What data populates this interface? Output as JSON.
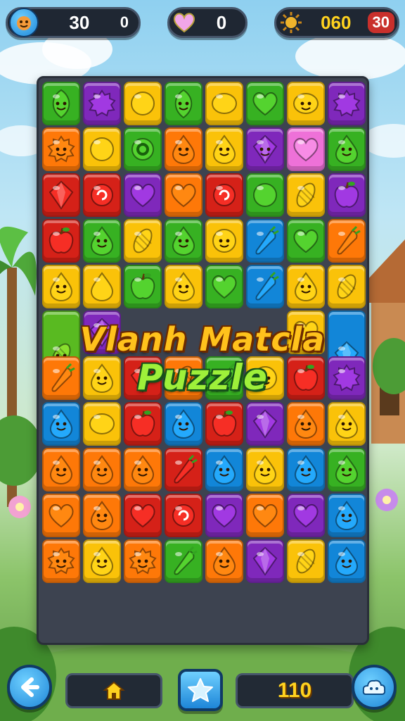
{
  "hud": {
    "lives_value": "30",
    "lives_extra": "0",
    "hearts_value": "0",
    "coins_value": "060",
    "coins_badge": "30"
  },
  "title": {
    "line1": "Vlanh Matcla",
    "line2": "Puzzle"
  },
  "footer": {
    "moves_value": "110"
  },
  "colors": {
    "board": "#3d4350",
    "title_line1": "#ffc21c",
    "title_line2": "#9ef03a",
    "button_blue": "#1e86d8"
  },
  "board": {
    "cols": 8,
    "rows": 12,
    "tiles": [
      [
        "green-leaf-face",
        "purple-splat",
        "yellow-orb",
        "green-leaf-face",
        "yellow-lemon",
        "green-heart",
        "yellow-lemon-face",
        "purple-splat"
      ],
      [
        "orange-sun-face",
        "yellow-orb",
        "green-ring",
        "orange-drop-face",
        "yellow-drop-face",
        "purple-gem-face",
        "pink-heart",
        "green-drop-face"
      ],
      [
        "red-gem",
        "red-swirl",
        "purple-heart",
        "orange-heart",
        "red-swirl",
        "green-orb",
        "yellow-corn",
        "purple-berry"
      ],
      [
        "red-apple",
        "green-drop-face",
        "yellow-corn",
        "green-drop-face",
        "yellow-orb-face",
        "blue-popsicle",
        "green-heart",
        "orange-carrot"
      ],
      [
        "yellow-drop-face",
        "yellow-drop",
        "green-apple",
        "yellow-drop-face",
        "green-heart",
        "blue-popsicle",
        "yellow-drop-face",
        "yellow-corn"
      ],
      [
        "corn-face-tall",
        "purple-gem",
        "empty",
        "empty",
        "empty",
        "empty",
        "yellow-heart",
        "blue-crystal-tall"
      ],
      [
        "orange-carrot",
        "yellow-drop-face",
        "red-gem",
        "orange-corn",
        "green-pepper",
        "yellow-orb-face",
        "red-apple",
        "purple-splat"
      ],
      [
        "blue-water-face",
        "yellow-lemon",
        "red-apple",
        "blue-water-face",
        "red-apple",
        "purple-gem",
        "orange-drop-face",
        "yellow-drop-face"
      ],
      [
        "orange-drop-face",
        "orange-drop-face",
        "orange-drop-face",
        "red-pepper",
        "blue-water-face",
        "yellow-drop-face",
        "blue-water-face",
        "green-drop-face"
      ],
      [
        "orange-heart",
        "orange-drop-face",
        "red-heart",
        "red-swirl",
        "purple-heart",
        "orange-heart",
        "purple-heart",
        "blue-water-face"
      ],
      [
        "orange-sun-face",
        "yellow-drop-face",
        "orange-sun-face",
        "green-pepper",
        "orange-drop-face",
        "purple-gem",
        "yellow-corn",
        "blue-water-face"
      ]
    ]
  }
}
